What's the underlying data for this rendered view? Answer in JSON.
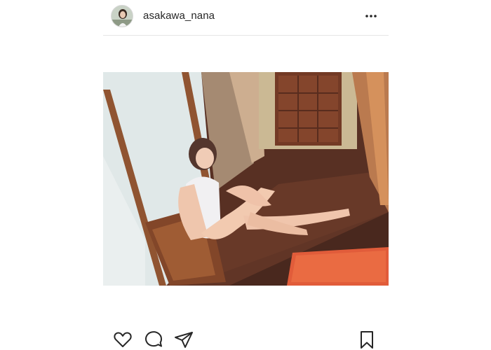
{
  "post": {
    "username": "asakawa_nana",
    "icons": {
      "avatar": "profile-photo",
      "more": "more-options-icon",
      "like": "heart-outline-icon",
      "comment": "comment-bubble-icon",
      "share": "paper-plane-icon",
      "save": "bookmark-outline-icon"
    },
    "colors": {
      "text": "#262626",
      "divider": "#e6e6e6",
      "background": "#ffffff"
    }
  }
}
